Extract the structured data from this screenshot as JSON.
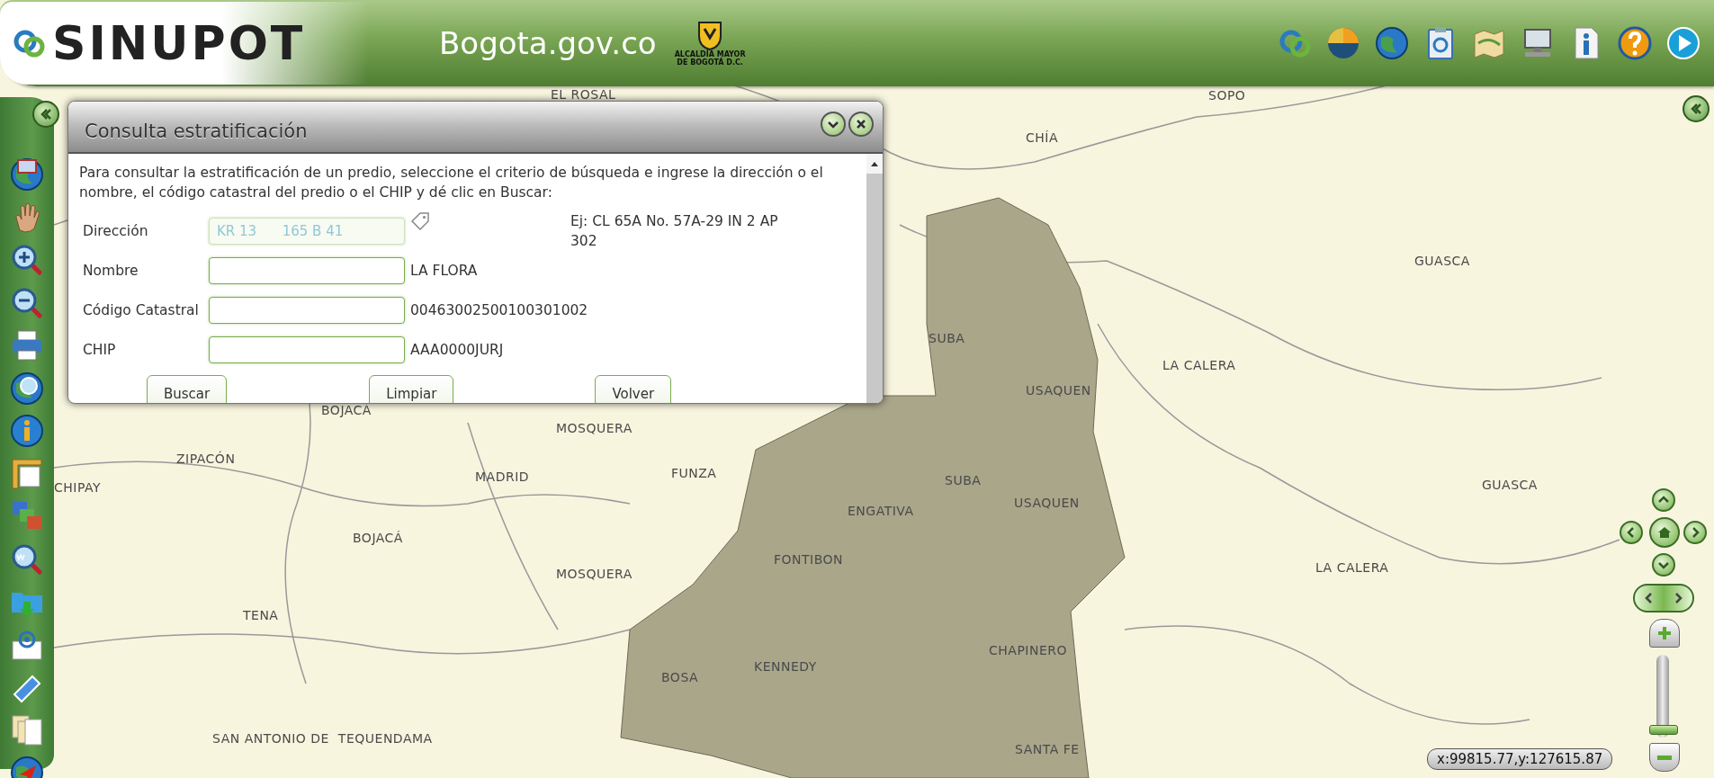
{
  "header": {
    "logo": "SINUPOT",
    "site": "Bogota.gov.co",
    "crest_caption": [
      "ALCALDÍA MAYOR",
      "DE BOGOTÁ D.C."
    ],
    "tools": [
      {
        "kind": "logo"
      },
      {
        "kind": "chart"
      },
      {
        "kind": "globe"
      },
      {
        "kind": "clipboard"
      },
      {
        "kind": "map"
      },
      {
        "kind": "computer"
      },
      {
        "kind": "document"
      },
      {
        "kind": "help"
      },
      {
        "kind": "play"
      }
    ]
  },
  "left_toolbar": {
    "tools": [
      {
        "kind": "extent"
      },
      {
        "kind": "hand"
      },
      {
        "kind": "zoom-in"
      },
      {
        "kind": "zoom-out"
      },
      {
        "kind": "printer"
      },
      {
        "kind": "search"
      },
      {
        "kind": "info"
      },
      {
        "kind": "ruler"
      },
      {
        "kind": "layers"
      },
      {
        "kind": "wms"
      },
      {
        "kind": "folder"
      },
      {
        "kind": "email"
      },
      {
        "kind": "eraser"
      },
      {
        "kind": "documents"
      },
      {
        "kind": "locate"
      }
    ]
  },
  "dialog": {
    "title": "Consulta estratificación",
    "intro": "Para consultar la estratificación de un predio, seleccione el criterio de búsqueda e ingrese la dirección o el nombre, el código catastral del predio o el CHIP y dé clic en Buscar:",
    "fields": [
      {
        "kind": "address",
        "label": "Dirección",
        "placeholder": "KR 13      165 B 41",
        "example": "Ej: CL 65A No. 57A-29 IN 2 AP 302"
      },
      {
        "kind": "text",
        "label": "Nombre",
        "example": "LA FLORA"
      },
      {
        "kind": "text",
        "label": "Código Catastral",
        "example": "00463002500100301002"
      },
      {
        "kind": "text",
        "label": "CHIP",
        "example": "AAA0000JURJ"
      }
    ],
    "buttons": [
      "Buscar",
      "Limpiar",
      "Volver"
    ]
  },
  "map": {
    "labels": [
      "EL ROSAL",
      "SOPO",
      "CHÍA",
      "GUASCA",
      "SUBA",
      "LA CALERA",
      "USAQUEN",
      "BOJACÁ",
      "MOSQUERA",
      "ZIPACÓN",
      "CHIPAY",
      "MADRID",
      "FUNZA",
      "SUBA",
      "GUASCA",
      "USAQUEN",
      "ENGATIVA",
      "BOJACÁ",
      "MOSQUERA",
      "FONTIBON",
      "LA CALERA",
      "TENA",
      "CHAPINERO",
      "BOSA",
      "KENNEDY",
      "SAN ANTONIO DE  TEQUENDAMA",
      "SANTA FE"
    ]
  },
  "zoom_slider": {
    "level": 0.05
  },
  "coordinates": "x:99815.77,y:127615.87"
}
